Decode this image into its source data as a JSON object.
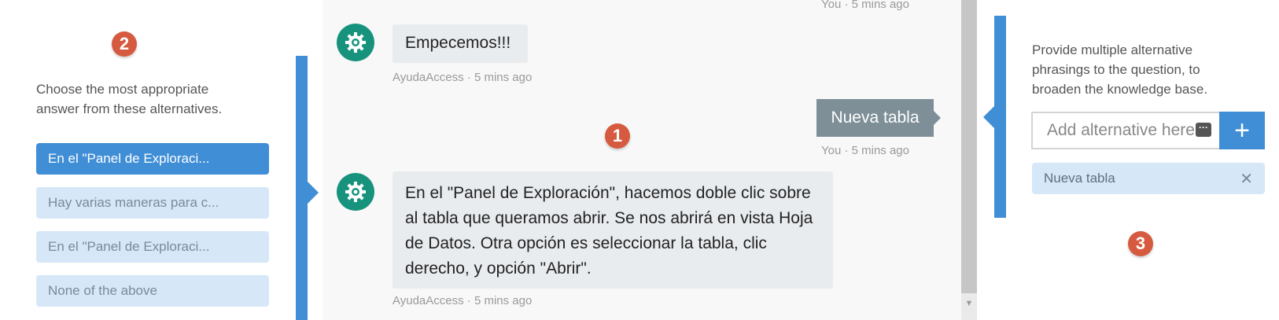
{
  "badges": {
    "chat": "1",
    "alternatives": "2",
    "phrasings": "3"
  },
  "left_panel": {
    "prompt": "Choose the most appropriate answer from these alternatives.",
    "options": [
      {
        "label": "En el \"Panel de Exploraci...",
        "selected": true
      },
      {
        "label": "Hay varias maneras para c...",
        "selected": false
      },
      {
        "label": "En el \"Panel de Exploraci...",
        "selected": false
      },
      {
        "label": "None of the above",
        "selected": false
      }
    ]
  },
  "chat": {
    "top_meta": "You · 5 mins ago",
    "messages": [
      {
        "sender": "bot",
        "text": "Empecemos!!!",
        "meta": "AyudaAccess · 5 mins ago"
      },
      {
        "sender": "user",
        "text": "Nueva tabla",
        "meta": "You · 5 mins ago"
      },
      {
        "sender": "bot",
        "text": "En el \"Panel de Exploración\", hacemos doble clic sobre al tabla que queramos abrir. Se nos abrirá en vista Hoja de Datos. Otra opción es seleccionar la tabla, clic derecho, y opción \"Abrir\".",
        "meta": "AyudaAccess · 5 mins ago"
      }
    ]
  },
  "right_panel": {
    "prompt": "Provide multiple alternative phrasings to the question, to broaden the knowledge base.",
    "input_placeholder": "Add alternative here",
    "add_label": "+",
    "tags": [
      {
        "label": "Nueva tabla"
      }
    ]
  },
  "colors": {
    "accent": "#3f8ed6",
    "badge": "#d65a3f",
    "avatar": "#17937d",
    "user_bubble": "#7e8f98"
  },
  "icons": {
    "avatar": "gear-icon",
    "tag_remove": "close-icon",
    "add": "plus-icon",
    "input_extra": "ellipsis-icon"
  }
}
